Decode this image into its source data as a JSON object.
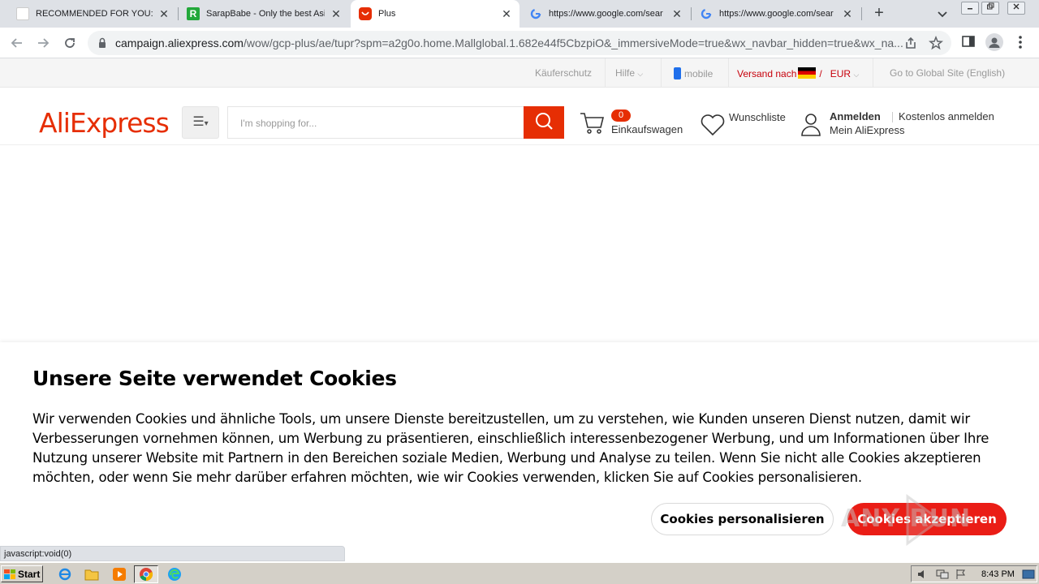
{
  "browser": {
    "tabs": [
      {
        "title": "RECOMMENDED FOR YOU:",
        "favicon": "blank-page-icon",
        "active": false
      },
      {
        "title": "SarapBabe - Only the best Asi",
        "favicon": "r-green-icon",
        "active": false
      },
      {
        "title": "Plus",
        "favicon": "aliexpress-icon",
        "active": true
      },
      {
        "title": "https://www.google.com/sear",
        "favicon": "google-g-icon",
        "active": false
      },
      {
        "title": "https://www.google.com/sear",
        "favicon": "google-g-icon",
        "active": false
      }
    ],
    "tab_close_glyph": "✕",
    "new_tab_glyph": "+",
    "url_host": "campaign.aliexpress.com",
    "url_path": "/wow/gcp-plus/ae/tupr?spm=a2g0o.home.Mallglobal.1.682e44f5CbzpiO&_immersiveMode=true&wx_navbar_hidden=true&wx_na..."
  },
  "topbar": {
    "buyer_protection": "Käuferschutz",
    "help": "Hilfe",
    "mobile": "mobile",
    "ship_to": "Versand nach",
    "currency_sep": "/",
    "currency": "EUR",
    "global_site": "Go to Global Site (English)"
  },
  "header": {
    "logo": "AliExpress",
    "search_placeholder": "I'm shopping for...",
    "cart_count": "0",
    "cart_label": "Einkaufswagen",
    "wishlist_label": "Wunschliste",
    "sign_in": "Anmelden",
    "register": "Kostenlos anmelden",
    "my_account": "Mein AliExpress"
  },
  "cookie_banner": {
    "title": "Unsere Seite verwendet Cookies",
    "body": "Wir verwenden Cookies und ähnliche Tools, um unsere Dienste bereitzustellen, um zu verstehen, wie Kunden unseren Dienst nutzen, damit wir Verbesserungen vornehmen können, um Werbung zu präsentieren, einschließlich interessenbezogener Werbung, und um Informationen über Ihre Nutzung unserer Website mit Partnern in den Bereichen soziale Medien, Werbung und Analyse zu teilen. Wenn Sie nicht alle Cookies akzeptieren möchten, oder wenn Sie mehr darüber erfahren möchten, wie wir Cookies verwenden, klicken Sie auf Cookies personalisieren.",
    "personalize_button": "Cookies personalisieren",
    "accept_button": "Cookies akzeptieren"
  },
  "status_bar": "javascript:void(0)",
  "taskbar": {
    "start": "Start",
    "clock": "8:43 PM"
  },
  "watermark": "ANY RUN",
  "colors": {
    "brand_red": "#e62e04",
    "accept_red": "#ea1d16",
    "topbar_red": "#c7000b"
  }
}
